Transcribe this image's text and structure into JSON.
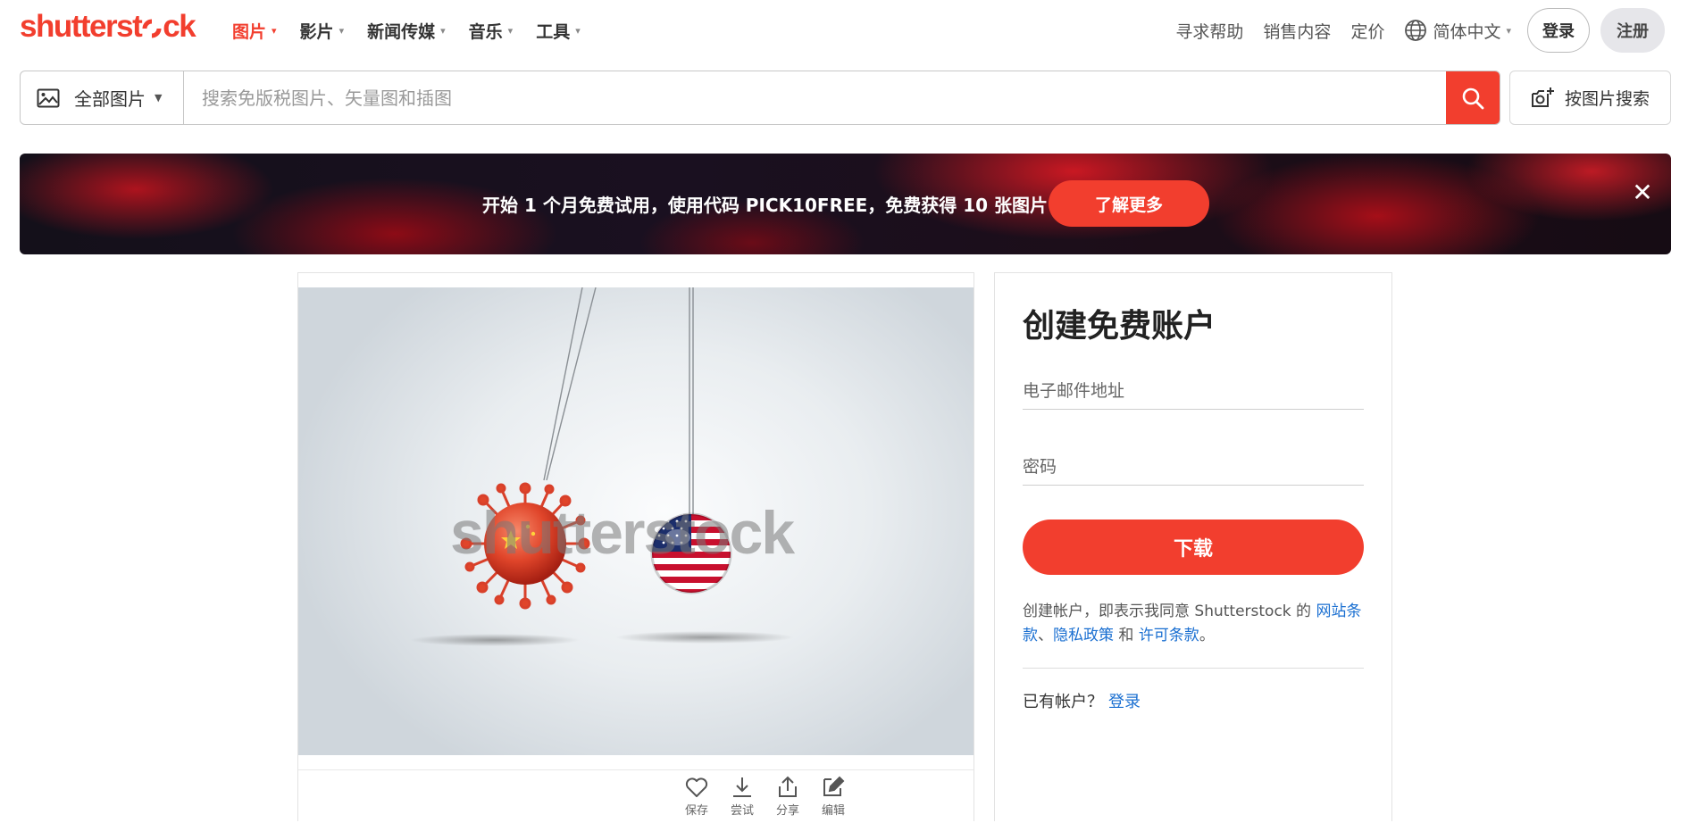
{
  "brand": {
    "logo_text_before": "shutterst",
    "logo_text_after": "ck",
    "accent_color": "#f23e2e"
  },
  "nav": {
    "items": [
      {
        "label": "图片",
        "active": true
      },
      {
        "label": "影片",
        "active": false
      },
      {
        "label": "新闻传媒",
        "active": false
      },
      {
        "label": "音乐",
        "active": false
      },
      {
        "label": "工具",
        "active": false
      }
    ],
    "right": {
      "help": "寻求帮助",
      "sell": "销售内容",
      "pricing": "定价",
      "language": "简体中文",
      "login": "登录",
      "signup": "注册"
    }
  },
  "search": {
    "type_label": "全部图片",
    "placeholder": "搜索免版税图片、矢量图和插图",
    "image_search_label": "按图片搜索"
  },
  "promo": {
    "text": "开始 1 个月免费试用，使用代码 PICK10FREE，免费获得 10 张图片",
    "button": "了解更多",
    "close": "✕"
  },
  "image_card": {
    "watermark": "shutterstock",
    "actions": [
      {
        "icon": "heart-icon",
        "label": "保存"
      },
      {
        "icon": "download-icon",
        "label": "尝试"
      },
      {
        "icon": "share-icon",
        "label": "分享"
      },
      {
        "icon": "edit-icon",
        "label": "编辑"
      }
    ]
  },
  "signup_panel": {
    "title": "创建免费账户",
    "email_placeholder": "电子邮件地址",
    "password_placeholder": "密码",
    "download_button": "下载",
    "terms_prefix": "创建帐户，即表示我同意 Shutterstock 的 ",
    "terms_link1": "网站条款",
    "terms_sep": "、",
    "terms_link2": "隐私政策",
    "terms_and": " 和 ",
    "terms_link3": "许可条款",
    "terms_end": "。",
    "have_account": "已有帐户？",
    "login_link": "登录"
  }
}
